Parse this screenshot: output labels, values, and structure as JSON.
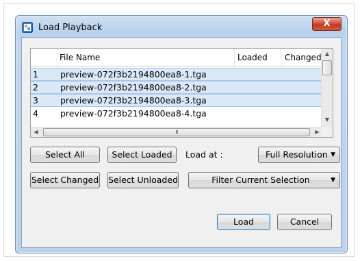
{
  "dialog": {
    "title": "Load Playback",
    "close_label": "X"
  },
  "table": {
    "columns": [
      "",
      "File Name",
      "Loaded",
      "Changed"
    ],
    "rows": [
      {
        "num": "1",
        "name": "preview-072f3b2194800ea8-1.tga",
        "loaded": "",
        "changed": "",
        "selected": true
      },
      {
        "num": "2",
        "name": "preview-072f3b2194800ea8-2.tga",
        "loaded": "",
        "changed": "",
        "selected": true
      },
      {
        "num": "3",
        "name": "preview-072f3b2194800ea8-3.tga",
        "loaded": "",
        "changed": "",
        "selected": true
      },
      {
        "num": "4",
        "name": "preview-072f3b2194800ea8-4.tga",
        "loaded": "",
        "changed": "",
        "selected": false
      }
    ],
    "scroll_grip": "III"
  },
  "buttons": {
    "select_all": "Select All",
    "select_loaded": "Select Loaded",
    "load_at_label": "Load at :",
    "resolution": "Full Resolution",
    "select_changed": "Select Changed",
    "select_unloaded": "Select Unloaded",
    "filter": "Filter Current Selection",
    "load": "Load",
    "cancel": "Cancel"
  },
  "icons": {
    "app": "playback-app-icon",
    "close": "close-icon",
    "dropdown": "chevron-down-icon"
  },
  "colors": {
    "selection": "#dae8f7",
    "close_button": "#c0391f",
    "title_gradient": "#c2d7ee"
  }
}
